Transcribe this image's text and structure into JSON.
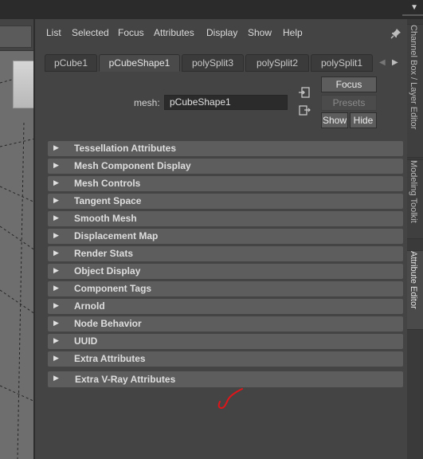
{
  "menu": [
    "List",
    "Selected",
    "Focus",
    "Attributes",
    "Display",
    "Show",
    "Help"
  ],
  "tabs": [
    "pCube1",
    "pCubeShape1",
    "polySplit3",
    "polySplit2",
    "polySplit1"
  ],
  "active_tab_index": 1,
  "mesh": {
    "label": "mesh:",
    "value": "pCubeShape1"
  },
  "buttons": {
    "focus": "Focus",
    "presets": "Presets",
    "show": "Show",
    "hide": "Hide"
  },
  "sections": [
    "Tessellation Attributes",
    "Mesh Component Display",
    "Mesh Controls",
    "Tangent Space",
    "Smooth Mesh",
    "Displacement Map",
    "Render Stats",
    "Object Display",
    "Component Tags",
    "Arnold",
    "Node Behavior",
    "UUID",
    "Extra Attributes"
  ],
  "last_section": "Extra V-Ray Attributes",
  "side_tabs": {
    "channel_box": "Channel Box / Layer Editor",
    "modeling_toolkit": "Modeling Toolkit",
    "attribute_editor": "Attribute Editor"
  },
  "colors": {
    "panel_bg": "#444444",
    "section_bg": "#5d5d5d",
    "annotation": "#e0151a"
  },
  "icons": {
    "pin": "pin-icon",
    "load_selected": "load-selected-icon",
    "copy_tab": "copy-tab-icon",
    "section_arrow": "triangle-right"
  }
}
